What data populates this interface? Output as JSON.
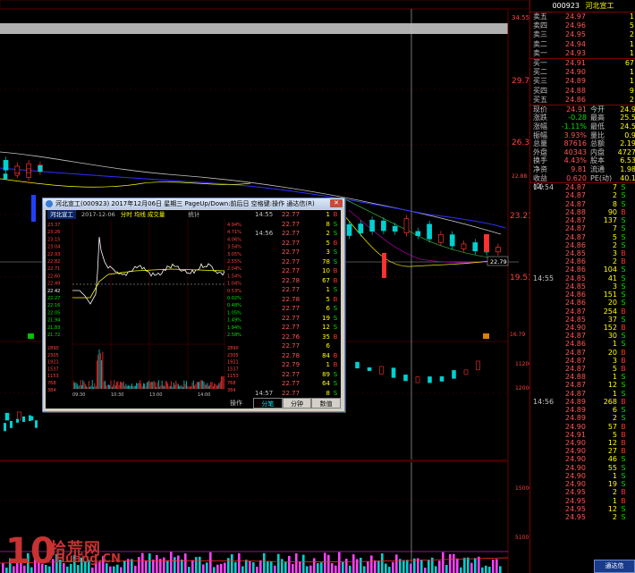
{
  "quote_panel": {
    "code": "000923",
    "name": "河北宣工",
    "asks": [
      {
        "label": "卖五",
        "price": "24.97",
        "vol": "1"
      },
      {
        "label": "卖四",
        "price": "24.96",
        "vol": "5"
      },
      {
        "label": "卖三",
        "price": "24.95",
        "vol": "2"
      },
      {
        "label": "卖二",
        "price": "24.94",
        "vol": "1"
      },
      {
        "label": "卖一",
        "price": "24.93",
        "vol": "1"
      }
    ],
    "bids": [
      {
        "label": "买一",
        "price": "24.91",
        "vol": "67"
      },
      {
        "label": "买二",
        "price": "24.90",
        "vol": "1"
      },
      {
        "label": "买三",
        "price": "24.89",
        "vol": "1"
      },
      {
        "label": "买四",
        "price": "24.88",
        "vol": "9"
      },
      {
        "label": "买五",
        "price": "24.86",
        "vol": "2"
      }
    ],
    "stats": [
      {
        "l1": "现价",
        "v1": "24.91",
        "l2": "今开",
        "v2": "24.9"
      },
      {
        "l1": "涨跌",
        "v1": "-0.28",
        "l2": "最高",
        "v2": "25.5"
      },
      {
        "l1": "涨幅",
        "v1": "-1.11%",
        "l2": "最低",
        "v2": "24.5"
      },
      {
        "l1": "振幅",
        "v1": "3.93%",
        "l2": "量比",
        "v2": "0.9"
      },
      {
        "l1": "总量",
        "v1": "87616",
        "l2": "总额",
        "v2": "2.19亿"
      },
      {
        "l1": "外盘",
        "v1": "40343",
        "l2": "内盘",
        "v2": "4727"
      },
      {
        "l1": "换手",
        "v1": "4.43%",
        "l2": "股本",
        "v2": "6.53亿"
      },
      {
        "l1": "净资",
        "v1": "9.81",
        "l2": "流通",
        "v2": "1.98亿"
      },
      {
        "l1": "收益(0)",
        "v1": "0.620",
        "l2": "PE(动)",
        "v2": "40.1"
      }
    ],
    "trades": [
      {
        "t": "14:54",
        "p": "24.87",
        "v": "7",
        "d": "S"
      },
      {
        "t": "",
        "p": "24.87",
        "v": "2",
        "d": "S"
      },
      {
        "t": "",
        "p": "24.87",
        "v": "8",
        "d": "S"
      },
      {
        "t": "",
        "p": "24.88",
        "v": "90",
        "d": "B"
      },
      {
        "t": "",
        "p": "24.87",
        "v": "137",
        "d": "S"
      },
      {
        "t": "",
        "p": "24.87",
        "v": "7",
        "d": "S"
      },
      {
        "t": "",
        "p": "24.87",
        "v": "5",
        "d": "S"
      },
      {
        "t": "",
        "p": "24.86",
        "v": "2",
        "d": "S"
      },
      {
        "t": "",
        "p": "24.85",
        "v": "3",
        "d": "B"
      },
      {
        "t": "",
        "p": "24.86",
        "v": "2",
        "d": "B"
      },
      {
        "t": "",
        "p": "24.86",
        "v": "104",
        "d": "S"
      },
      {
        "t": "14:55",
        "p": "24.85",
        "v": "41",
        "d": "S"
      },
      {
        "t": "",
        "p": "24.85",
        "v": "3",
        "d": "S"
      },
      {
        "t": "",
        "p": "24.86",
        "v": "151",
        "d": "S"
      },
      {
        "t": "",
        "p": "24.86",
        "v": "20",
        "d": "S"
      },
      {
        "t": "",
        "p": "24.87",
        "v": "254",
        "d": "B"
      },
      {
        "t": "",
        "p": "24.85",
        "v": "37",
        "d": "S"
      },
      {
        "t": "",
        "p": "24.90",
        "v": "152",
        "d": "B"
      },
      {
        "t": "",
        "p": "24.87",
        "v": "30",
        "d": "S"
      },
      {
        "t": "",
        "p": "24.86",
        "v": "1",
        "d": "S"
      },
      {
        "t": "",
        "p": "24.87",
        "v": "20",
        "d": "B"
      },
      {
        "t": "",
        "p": "24.87",
        "v": "3",
        "d": "B"
      },
      {
        "t": "",
        "p": "24.87",
        "v": "5",
        "d": "B"
      },
      {
        "t": "",
        "p": "24.88",
        "v": "1",
        "d": "S"
      },
      {
        "t": "",
        "p": "24.87",
        "v": "12",
        "d": "S"
      },
      {
        "t": "",
        "p": "24.87",
        "v": "1",
        "d": "S"
      },
      {
        "t": "14:56",
        "p": "24.89",
        "v": "268",
        "d": "B"
      },
      {
        "t": "",
        "p": "24.89",
        "v": "6",
        "d": "S"
      },
      {
        "t": "",
        "p": "24.89",
        "v": "2",
        "d": "S"
      },
      {
        "t": "",
        "p": "24.90",
        "v": "57",
        "d": "B"
      },
      {
        "t": "",
        "p": "24.91",
        "v": "5",
        "d": "B"
      },
      {
        "t": "",
        "p": "24.90",
        "v": "12",
        "d": "B"
      },
      {
        "t": "",
        "p": "24.90",
        "v": "27",
        "d": "B"
      },
      {
        "t": "",
        "p": "24.90",
        "v": "46",
        "d": "S"
      },
      {
        "t": "",
        "p": "24.90",
        "v": "55",
        "d": "S"
      },
      {
        "t": "",
        "p": "24.90",
        "v": "1",
        "d": "S"
      },
      {
        "t": "",
        "p": "24.90",
        "v": "19",
        "d": "S"
      },
      {
        "t": "",
        "p": "24.95",
        "v": "2",
        "d": "B"
      },
      {
        "t": "",
        "p": "24.95",
        "v": "1",
        "d": "B"
      },
      {
        "t": "",
        "p": "24.95",
        "v": "12",
        "d": "S"
      },
      {
        "t": "",
        "p": "24.95",
        "v": "2",
        "d": "S"
      }
    ]
  },
  "chart_axis": {
    "price_labels": [
      "34.55",
      "29.76",
      "26.37",
      "22.88",
      "22.35",
      "23.21",
      "19.51",
      "16.79"
    ],
    "last_price_tag": "22.79",
    "volume_labels": [
      "11200",
      "12000",
      "15000",
      "5100"
    ]
  },
  "popup": {
    "title": "河北宣工(000923) 2017年12月06日 星期三 PageUp/Down:前后日 空格键:操作 通达信(R)",
    "close": "✕",
    "tab_name": "河北宣工",
    "date": "2017-12-06",
    "mode": "分时 均线 成交量",
    "stat_label": "统计",
    "y_labels": [
      "23.37",
      "23.26",
      "23.15",
      "23.04",
      "22.93",
      "22.82",
      "22.71",
      "22.60",
      "22.49",
      "22.38",
      "22.27",
      "22.16",
      "22.05",
      "21.94",
      "21.83",
      "21.72",
      "21.61"
    ],
    "y_visible": [
      "23.37",
      "23.26",
      "23.15",
      "23.04",
      "22.93",
      "22.82",
      "22.71",
      "22.60",
      "22.49",
      "22.42",
      "22.27",
      "22.16",
      "22.05",
      "21.94",
      "21.83",
      "21.72"
    ],
    "pct_labels": [
      "4.94%",
      "4.71%",
      "4.06%",
      "3.54%",
      "3.05%",
      "2.55%",
      "2.04%",
      "1.54%",
      "1.04%",
      "0.53%",
      "0.02%",
      "0.48%",
      "1.05%",
      "1.49%",
      "1.94%",
      "2.58%",
      "3.05%"
    ],
    "vol_labels": [
      "2890",
      "2305",
      "1921",
      "1537",
      "1153",
      "768",
      "384"
    ],
    "time_labels": [
      "09:30",
      "10:30",
      "13:00",
      "14:00"
    ],
    "operate": "操作",
    "ticks": [
      {
        "t": "14:55",
        "p": "22.77",
        "v": "1",
        "d": "B"
      },
      {
        "t": "",
        "p": "22.77",
        "v": "8",
        "d": "S"
      },
      {
        "t": "14:56",
        "p": "22.77",
        "v": "2",
        "d": "S"
      },
      {
        "t": "",
        "p": "22.77",
        "v": "5",
        "d": "B"
      },
      {
        "t": "",
        "p": "22.77",
        "v": "3",
        "d": "S"
      },
      {
        "t": "",
        "p": "22.77",
        "v": "78",
        "d": "S"
      },
      {
        "t": "",
        "p": "22.77",
        "v": "10",
        "d": "B"
      },
      {
        "t": "",
        "p": "22.78",
        "v": "67",
        "d": "B"
      },
      {
        "t": "",
        "p": "22.77",
        "v": "1",
        "d": "S"
      },
      {
        "t": "",
        "p": "22.78",
        "v": "5",
        "d": "B"
      },
      {
        "t": "",
        "p": "22.77",
        "v": "6",
        "d": "S"
      },
      {
        "t": "",
        "p": "22.77",
        "v": "19",
        "d": "S"
      },
      {
        "t": "",
        "p": "22.77",
        "v": "12",
        "d": "S"
      },
      {
        "t": "",
        "p": "22.76",
        "v": "35",
        "d": "B"
      },
      {
        "t": "",
        "p": "22.77",
        "v": "6",
        "d": ""
      },
      {
        "t": "",
        "p": "22.78",
        "v": "84",
        "d": "B"
      },
      {
        "t": "",
        "p": "22.79",
        "v": "1",
        "d": "B"
      },
      {
        "t": "",
        "p": "22.77",
        "v": "89",
        "d": "S"
      },
      {
        "t": "",
        "p": "22.77",
        "v": "64",
        "d": "S"
      },
      {
        "t": "14:57",
        "p": "22.77",
        "v": "8",
        "d": "S"
      },
      {
        "t": "15:00",
        "p": "22.78",
        "v": "715",
        "d": ""
      }
    ],
    "tabs": [
      "分笔",
      "分钟",
      "数值"
    ]
  },
  "watermark": {
    "brand": "拾荒网",
    "domain": "Huang.CN"
  },
  "bottom_logo": "通达信"
}
